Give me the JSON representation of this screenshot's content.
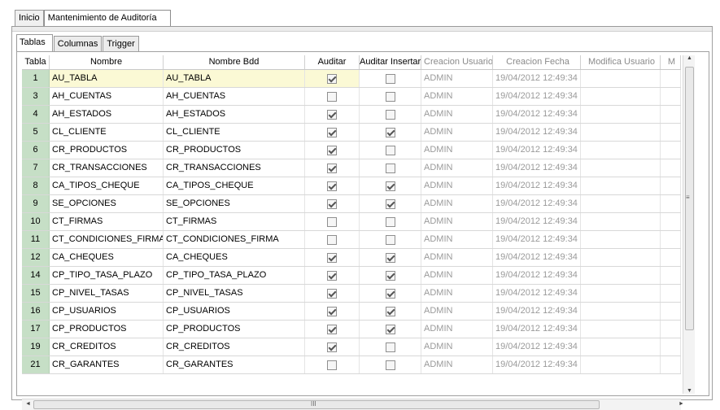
{
  "top_tabs": [
    "Inicio",
    "Mantenimiento de Auditoría"
  ],
  "inner_tabs": [
    "Tablas",
    "Columnas",
    "Trigger"
  ],
  "columns": [
    "Tabla",
    "Nombre",
    "Nombre Bdd",
    "Auditar",
    "Auditar Insertar",
    "Creacion Usuario",
    "Creacion Fecha",
    "Modifica Usuario",
    "M"
  ],
  "rows": [
    {
      "id": "1",
      "nombre": "AU_TABLA",
      "bdd": "AU_TABLA",
      "auditar": true,
      "insertar": false,
      "usuario": "ADMIN",
      "fecha": "19/04/2012 12:49:34 p."
    },
    {
      "id": "3",
      "nombre": "AH_CUENTAS",
      "bdd": "AH_CUENTAS",
      "auditar": false,
      "insertar": false,
      "usuario": "ADMIN",
      "fecha": "19/04/2012 12:49:34 p."
    },
    {
      "id": "4",
      "nombre": "AH_ESTADOS",
      "bdd": "AH_ESTADOS",
      "auditar": true,
      "insertar": false,
      "usuario": "ADMIN",
      "fecha": "19/04/2012 12:49:34 p."
    },
    {
      "id": "5",
      "nombre": "CL_CLIENTE",
      "bdd": "CL_CLIENTE",
      "auditar": true,
      "insertar": true,
      "usuario": "ADMIN",
      "fecha": "19/04/2012 12:49:34 p."
    },
    {
      "id": "6",
      "nombre": "CR_PRODUCTOS",
      "bdd": "CR_PRODUCTOS",
      "auditar": true,
      "insertar": false,
      "usuario": "ADMIN",
      "fecha": "19/04/2012 12:49:34 p."
    },
    {
      "id": "7",
      "nombre": "CR_TRANSACCIONES",
      "bdd": "CR_TRANSACCIONES",
      "auditar": true,
      "insertar": false,
      "usuario": "ADMIN",
      "fecha": "19/04/2012 12:49:34 p."
    },
    {
      "id": "8",
      "nombre": "CA_TIPOS_CHEQUE",
      "bdd": "CA_TIPOS_CHEQUE",
      "auditar": true,
      "insertar": true,
      "usuario": "ADMIN",
      "fecha": "19/04/2012 12:49:34 p."
    },
    {
      "id": "9",
      "nombre": "SE_OPCIONES",
      "bdd": "SE_OPCIONES",
      "auditar": true,
      "insertar": true,
      "usuario": "ADMIN",
      "fecha": "19/04/2012 12:49:34 p."
    },
    {
      "id": "10",
      "nombre": "CT_FIRMAS",
      "bdd": "CT_FIRMAS",
      "auditar": false,
      "insertar": false,
      "usuario": "ADMIN",
      "fecha": "19/04/2012 12:49:34 p."
    },
    {
      "id": "11",
      "nombre": "CT_CONDICIONES_FIRMA",
      "bdd": "CT_CONDICIONES_FIRMA",
      "auditar": false,
      "insertar": false,
      "usuario": "ADMIN",
      "fecha": "19/04/2012 12:49:34 p."
    },
    {
      "id": "12",
      "nombre": "CA_CHEQUES",
      "bdd": "CA_CHEQUES",
      "auditar": true,
      "insertar": true,
      "usuario": "ADMIN",
      "fecha": "19/04/2012 12:49:34 p."
    },
    {
      "id": "14",
      "nombre": "CP_TIPO_TASA_PLAZO",
      "bdd": "CP_TIPO_TASA_PLAZO",
      "auditar": true,
      "insertar": true,
      "usuario": "ADMIN",
      "fecha": "19/04/2012 12:49:34 p."
    },
    {
      "id": "15",
      "nombre": "CP_NIVEL_TASAS",
      "bdd": "CP_NIVEL_TASAS",
      "auditar": true,
      "insertar": true,
      "usuario": "ADMIN",
      "fecha": "19/04/2012 12:49:34 p."
    },
    {
      "id": "16",
      "nombre": "CP_USUARIOS",
      "bdd": "CP_USUARIOS",
      "auditar": true,
      "insertar": true,
      "usuario": "ADMIN",
      "fecha": "19/04/2012 12:49:34 p."
    },
    {
      "id": "17",
      "nombre": "CP_PRODUCTOS",
      "bdd": "CP_PRODUCTOS",
      "auditar": true,
      "insertar": true,
      "usuario": "ADMIN",
      "fecha": "19/04/2012 12:49:34 p."
    },
    {
      "id": "19",
      "nombre": "CR_CREDITOS",
      "bdd": "CR_CREDITOS",
      "auditar": true,
      "insertar": false,
      "usuario": "ADMIN",
      "fecha": "19/04/2012 12:49:34 p."
    },
    {
      "id": "21",
      "nombre": "CR_GARANTES",
      "bdd": "CR_GARANTES",
      "auditar": false,
      "insertar": false,
      "usuario": "ADMIN",
      "fecha": "19/04/2012 12:49:34 p."
    }
  ],
  "scrollbar": {
    "grip_h": "III",
    "grip_v": "≡",
    "arrow_left": "◄",
    "arrow_right": "►",
    "arrow_up": "▲",
    "arrow_down": "▼"
  }
}
